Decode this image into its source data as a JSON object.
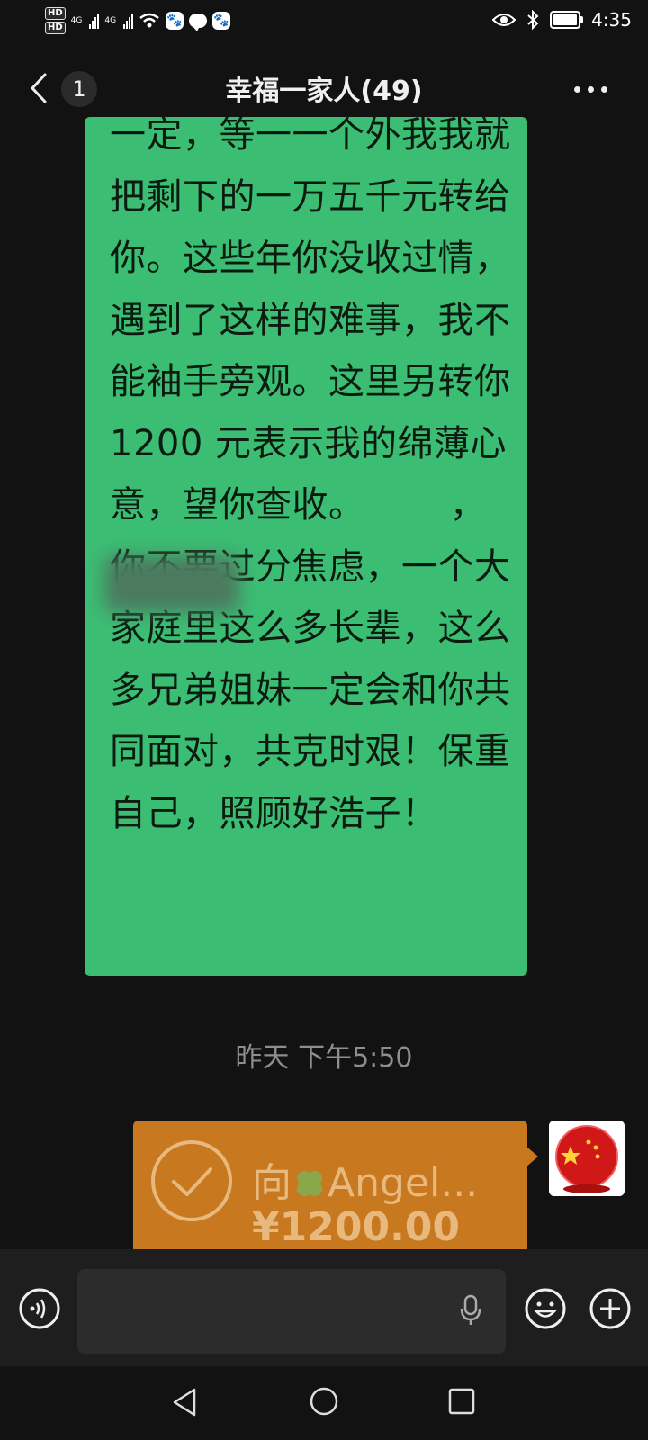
{
  "status_bar": {
    "hd1": "HD",
    "hd2": "HD",
    "net1": "4G",
    "net2": "4G",
    "time": "4:35",
    "battery_level": 0.85,
    "icons": [
      "hd-icon",
      "signal-icon",
      "wifi-icon",
      "baidu-icon",
      "message-icon",
      "eye-icon",
      "bluetooth-icon",
      "battery-icon"
    ]
  },
  "header": {
    "unread_count": "1",
    "title": "幸福一家人(49)"
  },
  "messages": {
    "green_text": "一定，等一一个外我我就把剩下的一万五千元转给你。这些年你没收过情，遇到了这样的难事，我不能袖手旁观。这里另转你1200 元表示我的绵薄心意，望你查收。 　　，你不要过分焦虑，一个大家庭里这么多长辈，这么多兄弟姐妹一定会和你共同面对，共克时艰！保重自己，照顾好浩子！",
    "timestamp": "昨天 下午5:50",
    "transfer": {
      "to_prefix": "向",
      "to_name": "Angel...",
      "amount": "¥1200.00"
    }
  },
  "colors": {
    "background": "#121212",
    "green_bubble": "#3cbd74",
    "transfer_bubble": "#c8781e",
    "transfer_text": "#e7b97e"
  }
}
